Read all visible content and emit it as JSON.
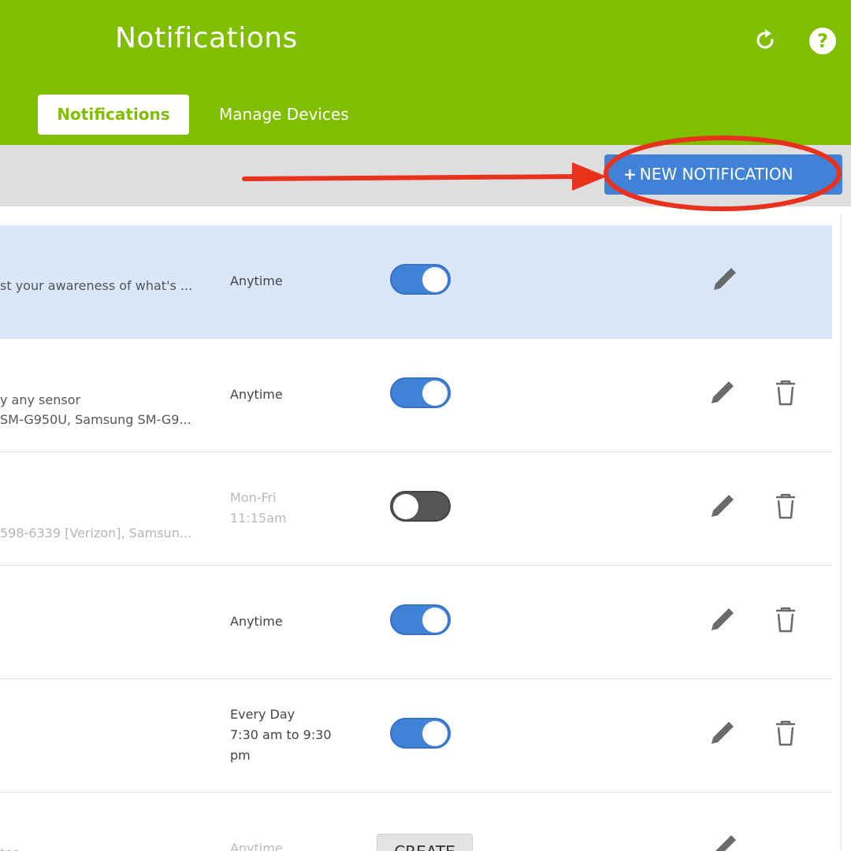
{
  "header": {
    "title": "Notifications",
    "tabs": [
      {
        "label": "Notifications",
        "active": true
      },
      {
        "label": "Manage Devices",
        "active": false
      }
    ],
    "refresh_icon": "refresh-icon",
    "help_icon": "help-icon",
    "help_glyph": "?"
  },
  "toolbar": {
    "new_plus": "+",
    "new_label": "NEW NOTIFICATION"
  },
  "rows": [
    {
      "desc1": "st your awareness of what's ...",
      "desc2": "",
      "when1": "Anytime",
      "when2": "",
      "when3": "",
      "toggle": "on",
      "muted": false,
      "trash": false
    },
    {
      "desc1": "y any sensor",
      "desc2": "SM-G950U, Samsung SM-G9...",
      "when1": "Anytime",
      "when2": "",
      "when3": "",
      "toggle": "on",
      "muted": false,
      "trash": true
    },
    {
      "desc1": "",
      "desc2": "598-6339 [Verizon], Samsun...",
      "when1": "Mon-Fri",
      "when2": "11:15am",
      "when3": "",
      "toggle": "off",
      "muted": true,
      "trash": true
    },
    {
      "desc1": "",
      "desc2": "",
      "when1": "Anytime",
      "when2": "",
      "when3": "",
      "toggle": "on",
      "muted": false,
      "trash": true
    },
    {
      "desc1": "",
      "desc2": "",
      "when1": "Every Day",
      "when2": "7:30 am to 9:30",
      "when3": "pm",
      "toggle": "on",
      "muted": false,
      "trash": true
    },
    {
      "desc1": "",
      "desc2": "tes",
      "when1": "Anytime",
      "when2": "",
      "when3": "",
      "create_label": "CREATE",
      "muted": true
    }
  ],
  "colors": {
    "brand_green": "#7fbf00",
    "accent_blue": "#3f82d8",
    "annotation_red": "#e8321e",
    "selected_row": "#d9e7f8"
  }
}
